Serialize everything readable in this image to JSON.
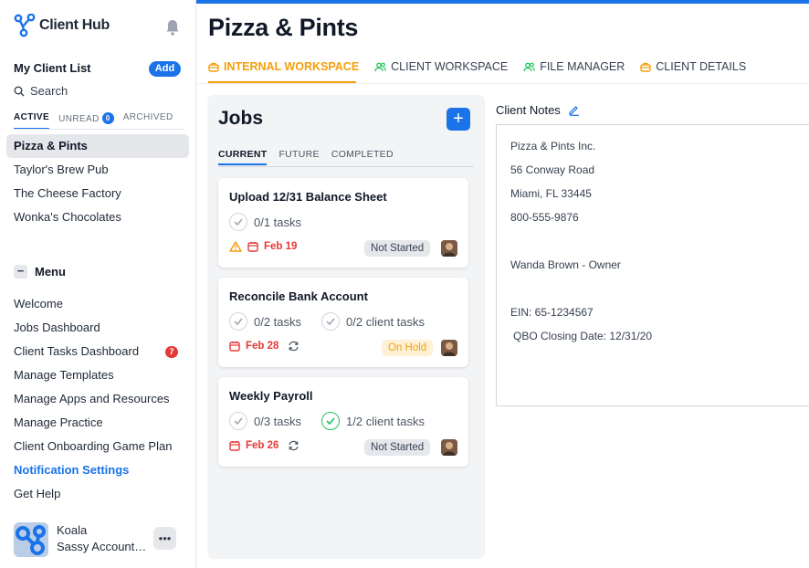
{
  "app": {
    "name": "Client Hub"
  },
  "sidebar": {
    "client_list_title": "My Client List",
    "add_label": "Add",
    "search_label": "Search",
    "client_tabs": [
      {
        "label": "ACTIVE"
      },
      {
        "label": "UNREAD",
        "badge": "0"
      },
      {
        "label": "ARCHIVED"
      }
    ],
    "clients": [
      "Pizza & Pints",
      "Taylor's Brew Pub",
      "The Cheese Factory",
      "Wonka's Chocolates"
    ],
    "menu_title": "Menu",
    "menu_items": [
      "Welcome",
      "Jobs Dashboard",
      "Client Tasks Dashboard",
      "Manage Templates",
      "Manage Apps and Resources",
      "Manage Practice",
      "Client Onboarding Game Plan",
      "Notification Settings",
      "Get Help"
    ],
    "client_tasks_badge": "7",
    "user": {
      "name": "Koala",
      "org": "Sassy Accounting"
    }
  },
  "main": {
    "title": "Pizza & Pints",
    "tabs": [
      "INTERNAL WORKSPACE",
      "CLIENT WORKSPACE",
      "FILE MANAGER",
      "CLIENT DETAILS"
    ]
  },
  "jobs": {
    "title": "Jobs",
    "tabs": [
      "CURRENT",
      "FUTURE",
      "COMPLETED"
    ],
    "cards": [
      {
        "title": "Upload 12/31 Balance Sheet",
        "tasks": "0/1 tasks",
        "date": "Feb 19",
        "status": "Not Started"
      },
      {
        "title": "Reconcile Bank Account",
        "tasks": "0/2 tasks",
        "client_tasks": "0/2 client tasks",
        "date": "Feb 28",
        "status": "On Hold"
      },
      {
        "title": "Weekly Payroll",
        "tasks": "0/3 tasks",
        "client_tasks": "1/2 client tasks",
        "date": "Feb 26",
        "status": "Not Started"
      }
    ]
  },
  "notes": {
    "label": "Client Notes",
    "lines": [
      "Pizza & Pints Inc.",
      "56 Conway Road",
      "Miami, FL 33445",
      "800-555-9876",
      "Wanda Brown - Owner",
      "EIN: 65-1234567",
      "QBO Closing Date: 12/31/20"
    ]
  },
  "colors": {
    "accent": "#1a73e8",
    "active_tab": "#f59e0b",
    "due_date": "#e53935",
    "done_check": "#22c55e"
  }
}
